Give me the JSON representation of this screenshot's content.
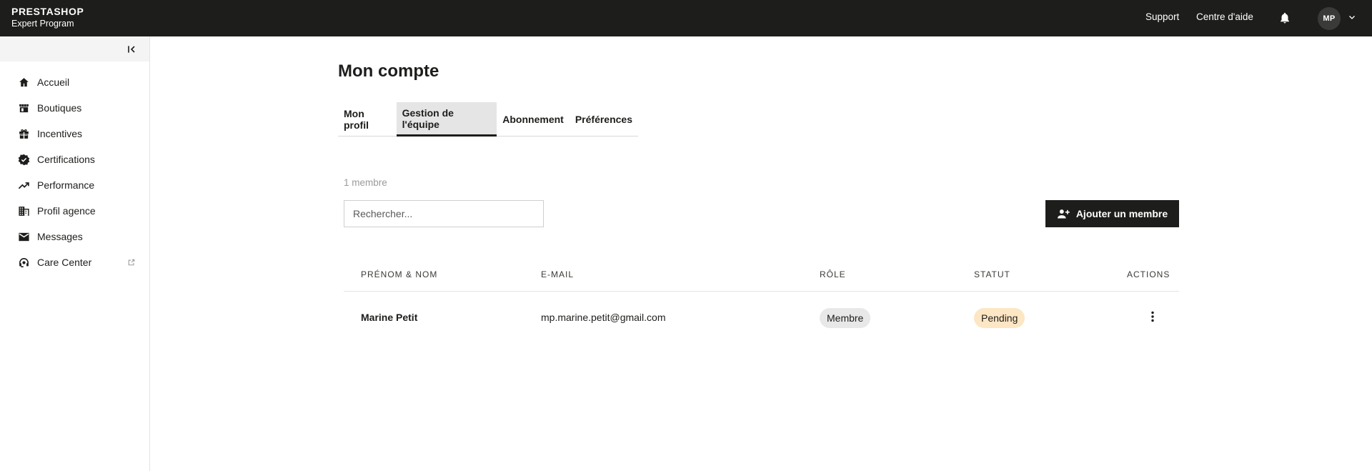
{
  "header": {
    "brand_name": "PRESTASHOP",
    "brand_sub": "Expert Program",
    "support": "Support",
    "help": "Centre d'aide",
    "avatar_initials": "MP"
  },
  "sidebar": {
    "items": [
      {
        "label": "Accueil",
        "icon": "home-icon"
      },
      {
        "label": "Boutiques",
        "icon": "store-icon"
      },
      {
        "label": "Incentives",
        "icon": "gift-icon"
      },
      {
        "label": "Certifications",
        "icon": "verified-icon"
      },
      {
        "label": "Performance",
        "icon": "trending-up-icon"
      },
      {
        "label": "Profil agence",
        "icon": "building-icon"
      },
      {
        "label": "Messages",
        "icon": "mail-icon"
      },
      {
        "label": "Care Center",
        "icon": "support-agent-icon"
      }
    ]
  },
  "main": {
    "title": "Mon compte",
    "tabs": [
      {
        "label": "Mon profil",
        "active": false
      },
      {
        "label": "Gestion de l'équipe",
        "active": true
      },
      {
        "label": "Abonnement",
        "active": false
      },
      {
        "label": "Préférences",
        "active": false
      }
    ],
    "member_count": "1 membre",
    "search_placeholder": "Rechercher...",
    "add_member_label": "Ajouter un membre",
    "table": {
      "columns": [
        "PRÉNOM & NOM",
        "E-MAIL",
        "RÔLE",
        "STATUT",
        "ACTIONS"
      ],
      "rows": [
        {
          "name": "Marine Petit",
          "email": "mp.marine.petit@gmail.com",
          "role": "Membre",
          "status": "Pending"
        }
      ]
    }
  },
  "colors": {
    "topbar": "#1d1d1b",
    "active_tab_bg": "#e5e5e5",
    "pending_badge": "#fde6c4",
    "role_badge": "#e8e8e8"
  }
}
